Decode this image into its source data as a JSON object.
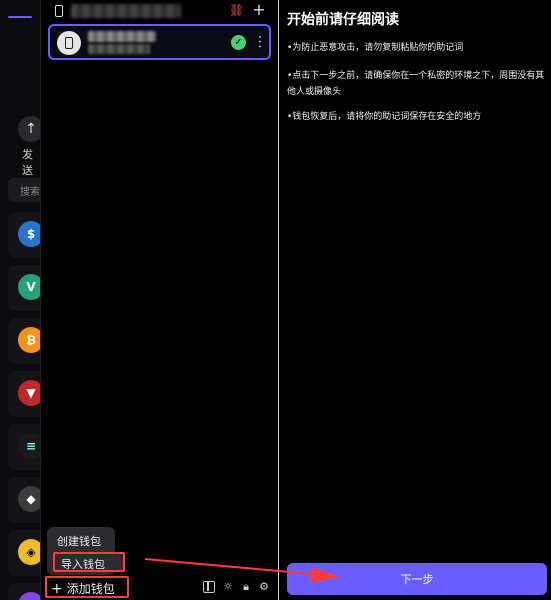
{
  "background_app": {
    "send_label": "发送",
    "search_placeholder": "搜索"
  },
  "wallet_panel": {
    "selected_wallet_status": "selected",
    "menu": {
      "create_label": "创建钱包",
      "import_label": "导入钱包"
    },
    "add_wallet_label": "添加钱包"
  },
  "instructions": {
    "title": "开始前请仔细阅读",
    "items": [
      "•为防止恶意攻击，请勿复制粘贴你的助记词",
      "•点击下一步之前，请确保你在一个私密的环境之下，周围没有其他人或摄像头",
      "•钱包恢复后，请将你的助记词保存在安全的地方"
    ],
    "next_button_label": "下一步"
  },
  "colors": {
    "accent": "#6b5cff",
    "highlight": "#ff3b3b",
    "success": "#44d17a",
    "disconnect": "#ff4d4d"
  }
}
